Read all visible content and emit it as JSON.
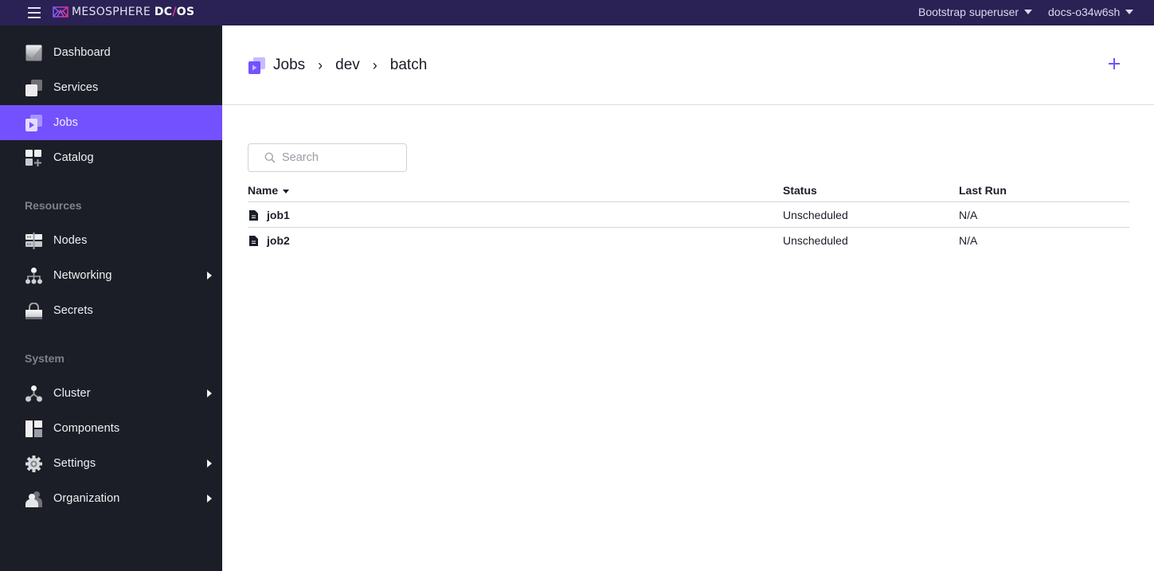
{
  "header": {
    "menu_icon": "hamburger-icon",
    "logo_text_light": "MESOSPHERE ",
    "logo_text_bold_1": "DC",
    "logo_text_slash": "/",
    "logo_text_bold_2": "OS",
    "user_label": "Bootstrap superuser",
    "cluster_label": "docs-o34w6sh"
  },
  "sidebar": {
    "items_top": [
      {
        "label": "Dashboard",
        "icon": "dashboard-icon",
        "active": false
      },
      {
        "label": "Services",
        "icon": "services-icon",
        "active": false
      },
      {
        "label": "Jobs",
        "icon": "jobs-icon",
        "active": true
      },
      {
        "label": "Catalog",
        "icon": "catalog-icon",
        "active": false
      }
    ],
    "resources_heading": "Resources",
    "items_resources": [
      {
        "label": "Nodes",
        "icon": "nodes-icon",
        "has_submenu": false
      },
      {
        "label": "Networking",
        "icon": "networking-icon",
        "has_submenu": true
      },
      {
        "label": "Secrets",
        "icon": "lock-icon",
        "has_submenu": false
      }
    ],
    "system_heading": "System",
    "items_system": [
      {
        "label": "Cluster",
        "icon": "cluster-icon",
        "has_submenu": true
      },
      {
        "label": "Components",
        "icon": "components-icon",
        "has_submenu": false
      },
      {
        "label": "Settings",
        "icon": "gear-icon",
        "has_submenu": true
      },
      {
        "label": "Organization",
        "icon": "users-icon",
        "has_submenu": true
      }
    ]
  },
  "main": {
    "breadcrumb": [
      "Jobs",
      "dev",
      "batch"
    ],
    "breadcrumb_separator": "›",
    "add_button_icon": "plus-icon",
    "search": {
      "placeholder": "Search",
      "value": ""
    },
    "table": {
      "columns": [
        "Name",
        "Status",
        "Last Run"
      ],
      "sorted_by": "Name",
      "rows": [
        {
          "name": "job1",
          "status": "Unscheduled",
          "last_run": "N/A"
        },
        {
          "name": "job2",
          "status": "Unscheduled",
          "last_run": "N/A"
        }
      ]
    }
  },
  "colors": {
    "header_bg": "#2a2154",
    "sidebar_bg": "#1b1e27",
    "accent": "#7351ff",
    "logo_slash": "#e0339b"
  }
}
